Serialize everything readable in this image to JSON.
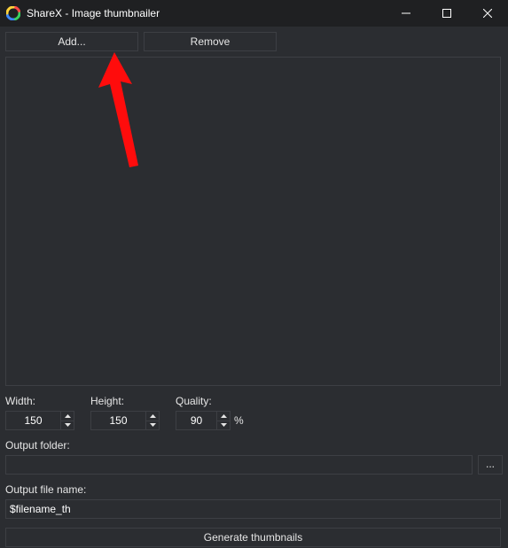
{
  "window": {
    "title": "ShareX - Image thumbnailer"
  },
  "toolbar": {
    "add_label": "Add...",
    "remove_label": "Remove"
  },
  "thumb": {
    "width_label": "Width:",
    "width_value": "150",
    "height_label": "Height:",
    "height_value": "150",
    "quality_label": "Quality:",
    "quality_value": "90",
    "quality_suffix": "%"
  },
  "output": {
    "folder_label": "Output folder:",
    "folder_value": "",
    "browse_label": "...",
    "filename_label": "Output file name:",
    "filename_value": "$filename_th"
  },
  "generate": {
    "label": "Generate thumbnails"
  },
  "annotation": {
    "arrow_color": "#ff0c0c"
  }
}
